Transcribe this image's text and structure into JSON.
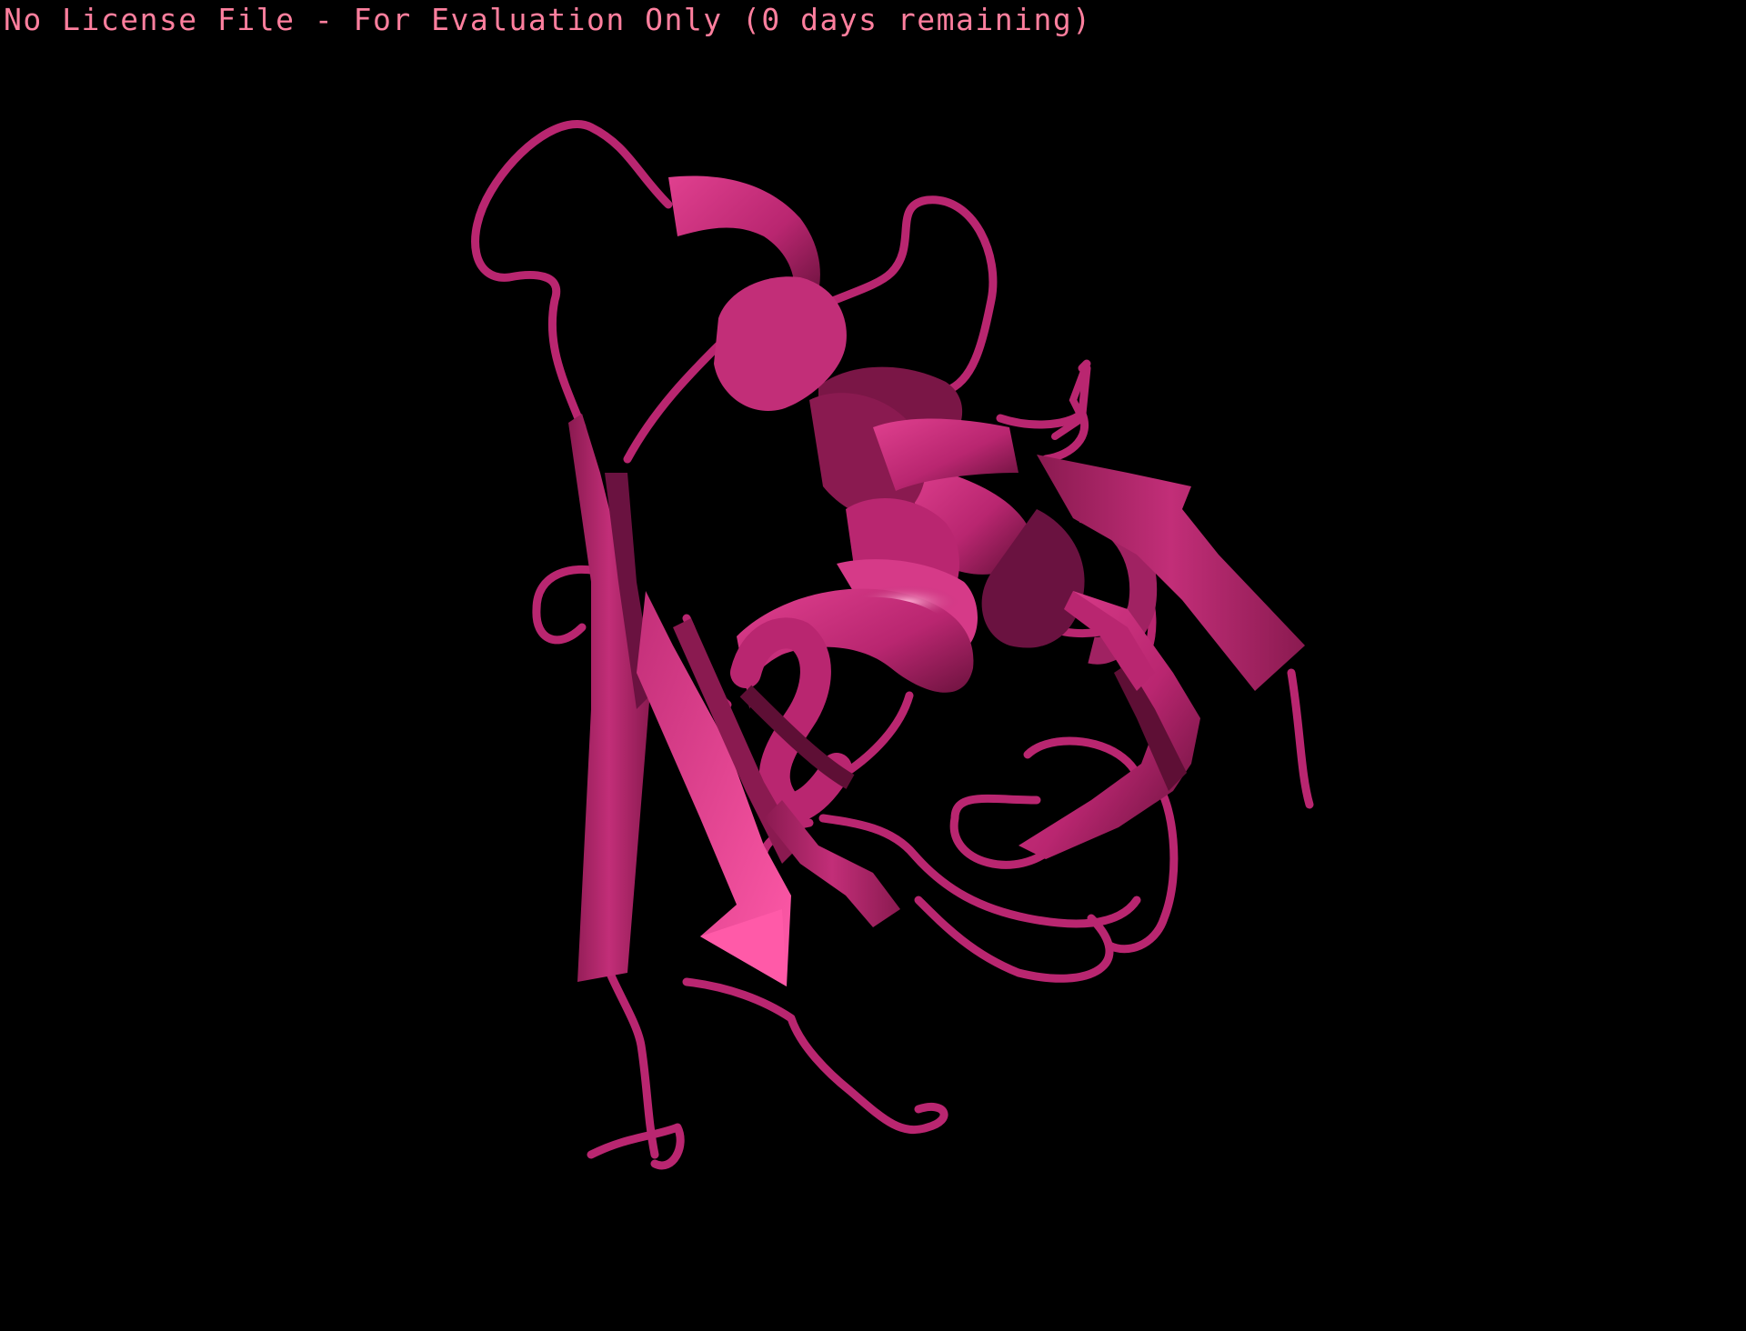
{
  "viewer": {
    "license_banner": "No License File - For Evaluation Only (0 days remaining)",
    "banner_color": "#ff7f9e",
    "background_color": "#000000"
  },
  "molecule": {
    "representation": "cartoon",
    "color": "#c22e78",
    "shadow_color": "#5e0f35",
    "highlight_color": "#ff5aa8"
  }
}
